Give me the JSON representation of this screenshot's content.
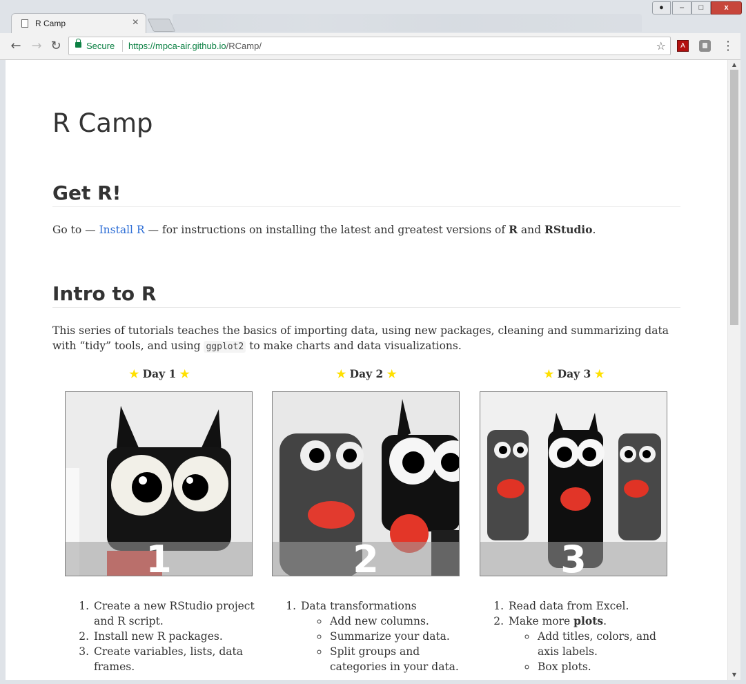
{
  "browser": {
    "tab_title": "R Camp",
    "tab_close": "×",
    "secure_label": "Secure",
    "url_base": "https://mpca-air.github.io",
    "url_path": "/RCamp/",
    "star_glyph": "☆",
    "menu_glyph": "⋮",
    "pdf_ext_label": "A",
    "win_user": "●",
    "win_min": "–",
    "win_max": "□",
    "win_close": "x"
  },
  "page": {
    "title": "R Camp",
    "get_r": {
      "heading": "Get R!",
      "text_before": "Go to — ",
      "link": "Install R",
      "text_middle": " — for instructions on installing the latest and greatest versions of ",
      "bold1": "R",
      "and": " and ",
      "bold2": "RStudio",
      "period": "."
    },
    "intro": {
      "heading": "Intro to R",
      "text1": "This series of tutorials teaches the basics of importing data, using new packages, cleaning and summarizing data with “tidy” tools, and using ",
      "code": "ggplot2",
      "text2": " to make charts and data visualizations."
    },
    "days": [
      {
        "label": "Day 1",
        "number": "1",
        "items": [
          {
            "text": "Create a new RStudio project and R script."
          },
          {
            "text": "Install new R packages."
          },
          {
            "text": "Create variables, lists, data frames."
          }
        ]
      },
      {
        "label": "Day 2",
        "number": "2",
        "item1": "Data transformations",
        "sub": [
          "Add new columns.",
          "Summarize your data.",
          "Split groups and categories in your data."
        ]
      },
      {
        "label": "Day 3",
        "number": "3",
        "item1": "Read data from Excel.",
        "item2_prefix": "Make more ",
        "item2_bold": "plots",
        "item2_suffix": ".",
        "sub": [
          "Add titles, colors, and axis labels.",
          "Box plots."
        ]
      }
    ],
    "star_glyph": "★"
  }
}
